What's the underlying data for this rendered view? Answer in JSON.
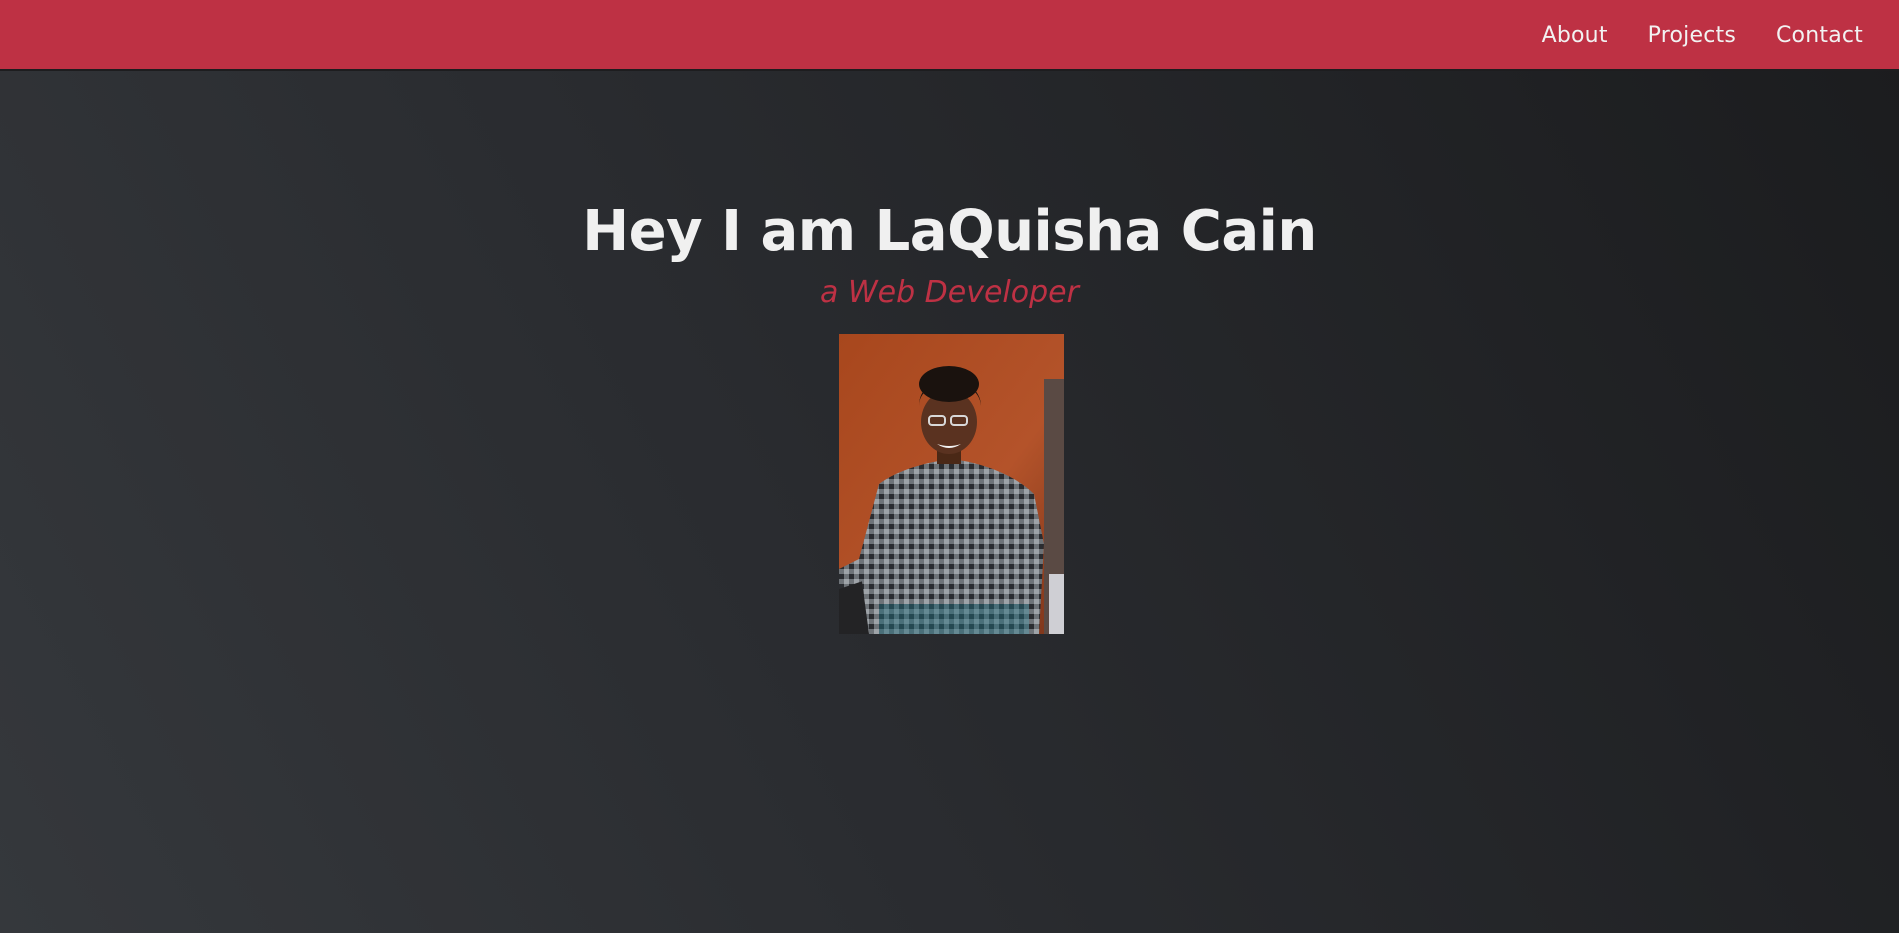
{
  "nav": {
    "links": [
      {
        "label": "About"
      },
      {
        "label": "Projects"
      },
      {
        "label": "Contact"
      }
    ]
  },
  "hero": {
    "title": "Hey I am LaQuisha Cain",
    "subtitle": "a Web Developer"
  },
  "colors": {
    "accent": "#be3144",
    "text": "#f0f0f0",
    "background_light": "#35383c",
    "background_dark": "#1b1c1e"
  }
}
